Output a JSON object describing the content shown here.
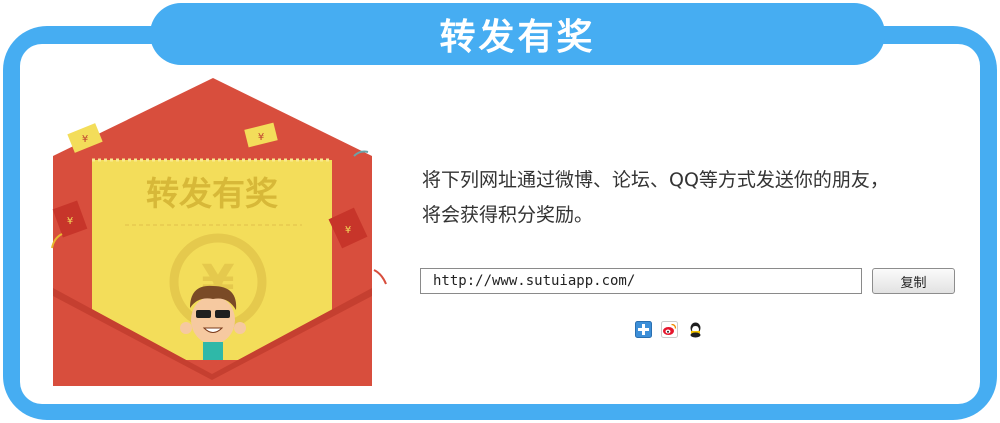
{
  "header": {
    "title": "转发有奖"
  },
  "illustration": {
    "card_text": "转发有奖"
  },
  "instruction": {
    "line1": "将下列网址通过微博、论坛、QQ等方式发送你的朋友，",
    "line2": "将会获得积分奖励。"
  },
  "share_link": {
    "url": "http://www.sutuiapp.com/",
    "copy_label": "复制"
  },
  "share_buttons": [
    {
      "icon": "add-share-icon"
    },
    {
      "icon": "weibo-icon"
    },
    {
      "icon": "qq-icon"
    }
  ],
  "colors": {
    "frame": "#46adf2",
    "envelope": "#d84e3d",
    "envelope_flap": "#cf4535",
    "card": "#f3dd5a",
    "card_text": "#d7b838"
  }
}
